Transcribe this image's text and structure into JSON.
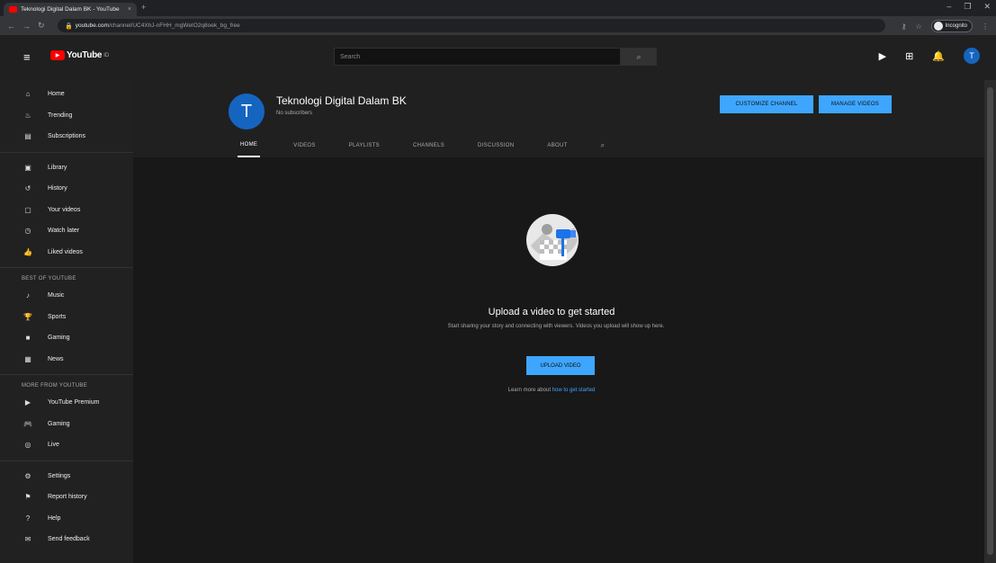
{
  "browser": {
    "tab_title": "Teknologi Digital Dalam BK - YouTube",
    "tab_close": "×",
    "new_tab": "+",
    "url_host": "youtube.com",
    "url_path": "/channel/UC4XhJ-nFHH_mgWeIO2q8oek_bg_free",
    "profile_label": "Incognito"
  },
  "yt": {
    "logo_text": "YouTube",
    "logo_region": "ID",
    "search_placeholder": "Search"
  },
  "sidebar": {
    "main_items": [
      {
        "label": "Home",
        "icon": "home-icon"
      },
      {
        "label": "Trending",
        "icon": "trending-icon"
      },
      {
        "label": "Subscriptions",
        "icon": "subscriptions-icon"
      }
    ],
    "library_items": [
      {
        "label": "Library",
        "icon": "library-icon"
      },
      {
        "label": "History",
        "icon": "history-icon"
      },
      {
        "label": "Your videos",
        "icon": "your-videos-icon"
      },
      {
        "label": "Watch later",
        "icon": "watch-later-icon"
      },
      {
        "label": "Liked videos",
        "icon": "liked-videos-icon"
      }
    ],
    "subscriptions_heading": "BEST OF YOUTUBE",
    "best_items": [
      {
        "label": "Music",
        "icon": "music-icon"
      },
      {
        "label": "Sports",
        "icon": "sports-icon"
      },
      {
        "label": "Gaming",
        "icon": "gaming-icon"
      },
      {
        "label": "News",
        "icon": "news-icon"
      }
    ],
    "more_heading": "MORE FROM YOUTUBE",
    "more_items": [
      {
        "label": "YouTube Premium",
        "icon": "premium-icon"
      },
      {
        "label": "Gaming",
        "icon": "gaming-controller-icon"
      },
      {
        "label": "Live",
        "icon": "live-icon"
      }
    ],
    "bottom_items": [
      {
        "label": "Settings",
        "icon": "settings-icon"
      },
      {
        "label": "Report history",
        "icon": "report-flag-icon"
      },
      {
        "label": "Help",
        "icon": "help-icon"
      },
      {
        "label": "Send feedback",
        "icon": "feedback-icon"
      }
    ]
  },
  "channel": {
    "avatar_letter": "T",
    "name": "Teknologi Digital Dalam BK",
    "subscribers": "No subscribers",
    "customize_label": "CUSTOMIZE CHANNEL",
    "manage_label": "MANAGE VIDEOS",
    "tabs": [
      "HOME",
      "VIDEOS",
      "PLAYLISTS",
      "CHANNELS",
      "DISCUSSION",
      "ABOUT"
    ]
  },
  "empty": {
    "title": "Upload a video to get started",
    "subtitle": "Start sharing your story and connecting with viewers. Videos you upload will show up here.",
    "upload_label": "UPLOAD VIDEO",
    "drafts_prefix": "Learn more about ",
    "drafts_link": "how to get started"
  },
  "colors": {
    "accent_blue": "#3ea6ff",
    "youtube_red": "#ff0000",
    "avatar_blue": "#1565c0"
  }
}
